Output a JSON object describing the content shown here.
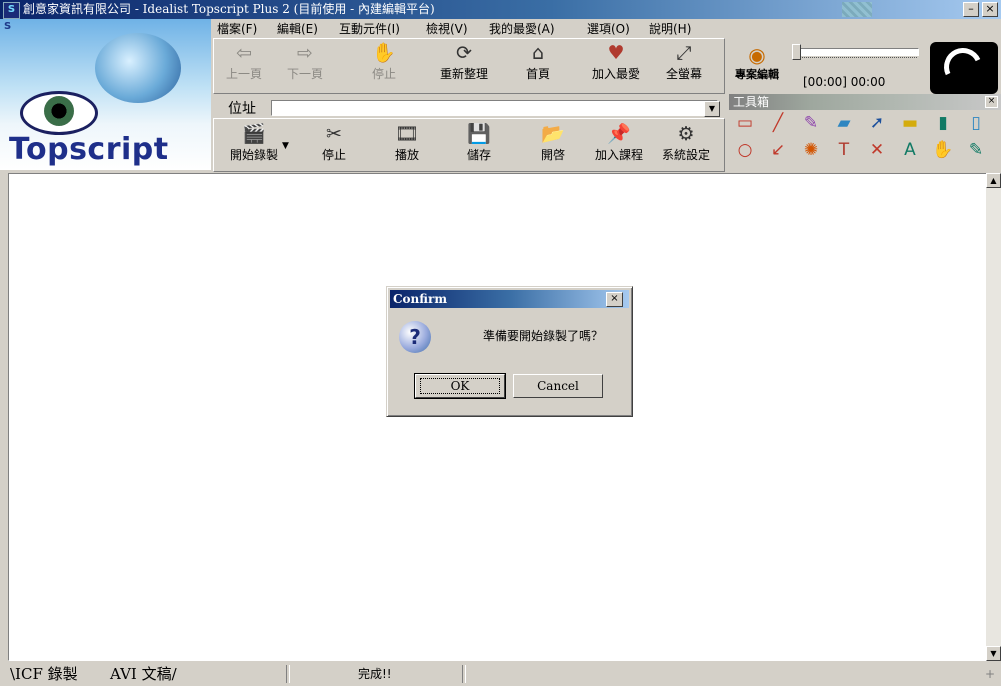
{
  "window": {
    "title": "創意家資訊有限公司 - Idealist Topscript Plus 2 (目前使用 - 內建編輯平台)",
    "minimize": "–",
    "close": "×"
  },
  "logo": {
    "brand": "Topscript",
    "mini": "S"
  },
  "menu": [
    "檔案(F)",
    "編輯(E)",
    "互動元件(I)",
    "檢視(V)",
    "我的最愛(A)",
    "選項(O)",
    "說明(H)"
  ],
  "nav_toolbar": [
    {
      "label": "上一頁",
      "icon": "page-back-icon",
      "glyph": "⇦",
      "enabled": false
    },
    {
      "label": "下一頁",
      "icon": "page-forward-icon",
      "glyph": "⇨",
      "enabled": false
    },
    {
      "label": "停止",
      "icon": "stop-hand-icon",
      "glyph": "✋",
      "enabled": false
    },
    {
      "label": "重新整理",
      "icon": "refresh-icon",
      "glyph": "⟳",
      "enabled": true
    },
    {
      "label": "首頁",
      "icon": "home-icon",
      "glyph": "⌂",
      "enabled": true
    },
    {
      "label": "加入最愛",
      "icon": "heart-icon",
      "glyph": "♥",
      "enabled": true
    },
    {
      "label": "全螢幕",
      "icon": "fullscreen-icon",
      "glyph": "⤢",
      "enabled": true
    }
  ],
  "address": {
    "label": "位址",
    "value": ""
  },
  "record_toolbar": [
    {
      "label": "開始錄製",
      "icon": "clapper-icon",
      "glyph": "🎬"
    },
    {
      "label": "停止",
      "icon": "stop-record-icon",
      "glyph": "✂"
    },
    {
      "label": "播放",
      "icon": "projector-icon",
      "glyph": "🎞"
    },
    {
      "label": "儲存",
      "icon": "save-disk-icon",
      "glyph": "💾"
    },
    {
      "label": "開啓",
      "icon": "open-folder-icon",
      "glyph": "📂"
    },
    {
      "label": "加入課程",
      "icon": "pin-icon",
      "glyph": "📌"
    },
    {
      "label": "系統設定",
      "icon": "settings-tools-icon",
      "glyph": "⚙"
    }
  ],
  "media": {
    "editor_label": "專案編輯",
    "time": "[00:00]  00:00",
    "position": 0
  },
  "toolbox": {
    "title": "工具箱",
    "close": "×",
    "tools": [
      {
        "name": "rect-pen-icon",
        "glyph": "▭",
        "color": "#c0392b"
      },
      {
        "name": "line-pen-icon",
        "glyph": "╱",
        "color": "#c0392b"
      },
      {
        "name": "freehand-pen-icon",
        "glyph": "✎",
        "color": "#8e44ad"
      },
      {
        "name": "highlighter-icon",
        "glyph": "▰",
        "color": "#2e86c1"
      },
      {
        "name": "pointer-icon",
        "glyph": "➚",
        "color": "#1b4f9c"
      },
      {
        "name": "eraser-icon",
        "glyph": "▬",
        "color": "#d4ac0d"
      },
      {
        "name": "trash-icon",
        "glyph": "▮",
        "color": "#117a65"
      },
      {
        "name": "new-page-icon",
        "glyph": "▯",
        "color": "#2e86c1"
      },
      {
        "name": "ellipse-pen-icon",
        "glyph": "○",
        "color": "#c0392b"
      },
      {
        "name": "arrow-pen-icon",
        "glyph": "↙",
        "color": "#c0392b"
      },
      {
        "name": "laser-icon",
        "glyph": "✺",
        "color": "#d35400"
      },
      {
        "name": "text-icon",
        "glyph": "T",
        "color": "#b03a2e"
      },
      {
        "name": "delete-x-icon",
        "glyph": "✕",
        "color": "#c0392b"
      },
      {
        "name": "board-icon",
        "glyph": "A",
        "color": "#117a65"
      },
      {
        "name": "hand-icon",
        "glyph": "✋",
        "color": "#d68910"
      },
      {
        "name": "edit-icon",
        "glyph": "✎",
        "color": "#117a65"
      }
    ]
  },
  "dialog": {
    "title": "Confirm",
    "close": "×",
    "icon": "question-icon",
    "icon_glyph": "?",
    "message": "準備要開始錄製了嗎？",
    "ok": "OK",
    "cancel": "Cancel"
  },
  "statusbar": {
    "tabs": [
      "\\ICF 錄製",
      "AVI 文稿/"
    ],
    "status": "完成!!",
    "grip": "+"
  },
  "scrollbar": {
    "up": "▲",
    "down": "▼"
  },
  "colors": {
    "title_dark": "#0a246a",
    "title_light": "#a6caf0",
    "face": "#d4d0c8"
  }
}
